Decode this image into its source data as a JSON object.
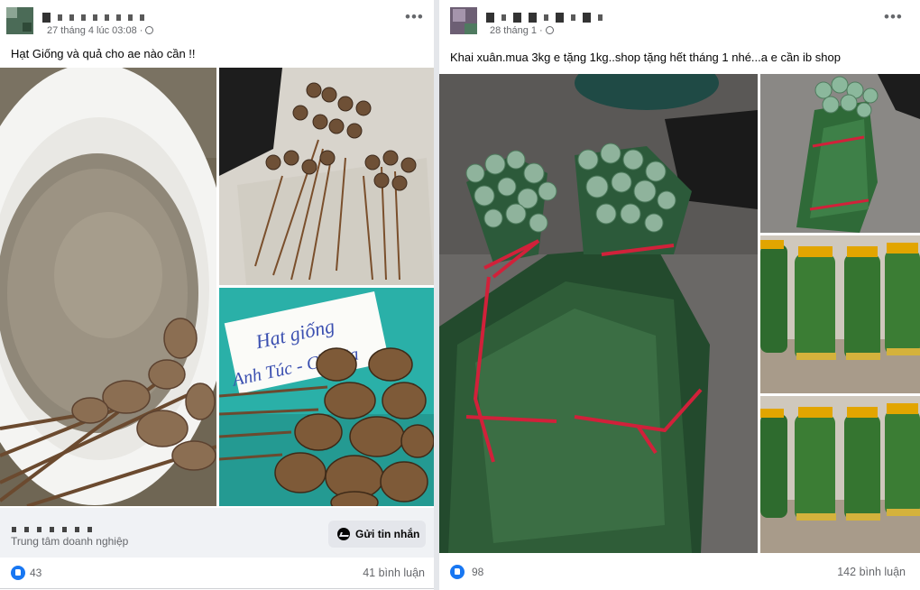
{
  "posts": [
    {
      "timestamp": "27 tháng 4 lúc 03:08 ·",
      "text": "Hạt Giống và quả cho ae nào cần !!",
      "photo_sign": {
        "line1": "Hạt giống",
        "line2": "Anh Túc - Cần Sa"
      },
      "business_label": "Trung tâm doanh nghiệp",
      "message_button": "Gửi tin nhắn",
      "likes": "43",
      "comments": "41 bình luận"
    },
    {
      "timestamp": "28 tháng 1 ·",
      "text": "Khai xuân.mua 3kg e tặng 1kg..shop tặng hết tháng 1 nhé...a e cần ib shop",
      "likes": "98",
      "comments": "142 bình luận"
    }
  ],
  "icons": {
    "more": "more-options-icon",
    "privacy": "globe-icon",
    "reaction": "like-icon",
    "messenger": "messenger-icon"
  },
  "colors": {
    "facebook_blue": "#1877f2",
    "meta_grey": "#65676b",
    "background": "#e4e6ea"
  }
}
